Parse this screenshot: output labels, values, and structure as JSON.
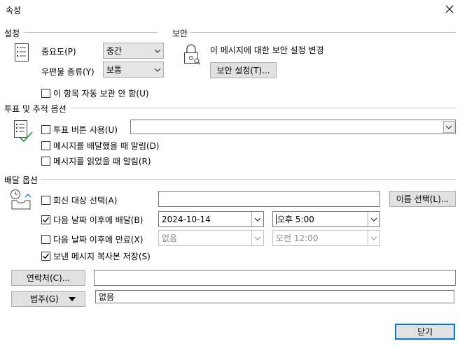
{
  "window": {
    "title": "속성"
  },
  "settings": {
    "section_label": "설정",
    "importance": {
      "label": "중요도(P)",
      "value": "중간"
    },
    "sensitivity": {
      "label": "우편물 종류(Y)",
      "value": "보통"
    },
    "no_autoarchive": {
      "label": "이 항목 자동 보관 안 함(U)",
      "checked": false
    }
  },
  "security": {
    "section_label": "보안",
    "description": "이 메시지에 대한 보안 설정 변경",
    "button_label": "보안 설정(T)..."
  },
  "voting": {
    "section_label": "투표 및 추적 옵션",
    "use_voting": {
      "label": "투표 버튼 사용(U)",
      "checked": false,
      "value": ""
    },
    "delivery_receipt": {
      "label": "메시지를 배달했을 때 알림(D)",
      "checked": false
    },
    "read_receipt": {
      "label": "메시지를 읽었을 때 알림(R)",
      "checked": false
    }
  },
  "delivery": {
    "section_label": "배달 옵션",
    "reply_to": {
      "label": "회신 대상 선택(A)",
      "checked": false,
      "value": ""
    },
    "select_names_button": "이름 선택(L)...",
    "defer": {
      "label": "다음 날짜 이후에 배달(B)",
      "checked": true,
      "date": "2024-10-14",
      "time": "오후 5:00"
    },
    "expire": {
      "label": "다음 날짜 이후에 만료(X)",
      "checked": false,
      "date": "없음",
      "time": "오전 12:00"
    },
    "save_copy": {
      "label": "보낸 메시지 복사본 저장(S)",
      "checked": true
    }
  },
  "contacts": {
    "button_label": "연락처(C)...",
    "value": ""
  },
  "categories": {
    "button_label": "범주(G)",
    "value": "없음"
  },
  "close_button": "닫기"
}
